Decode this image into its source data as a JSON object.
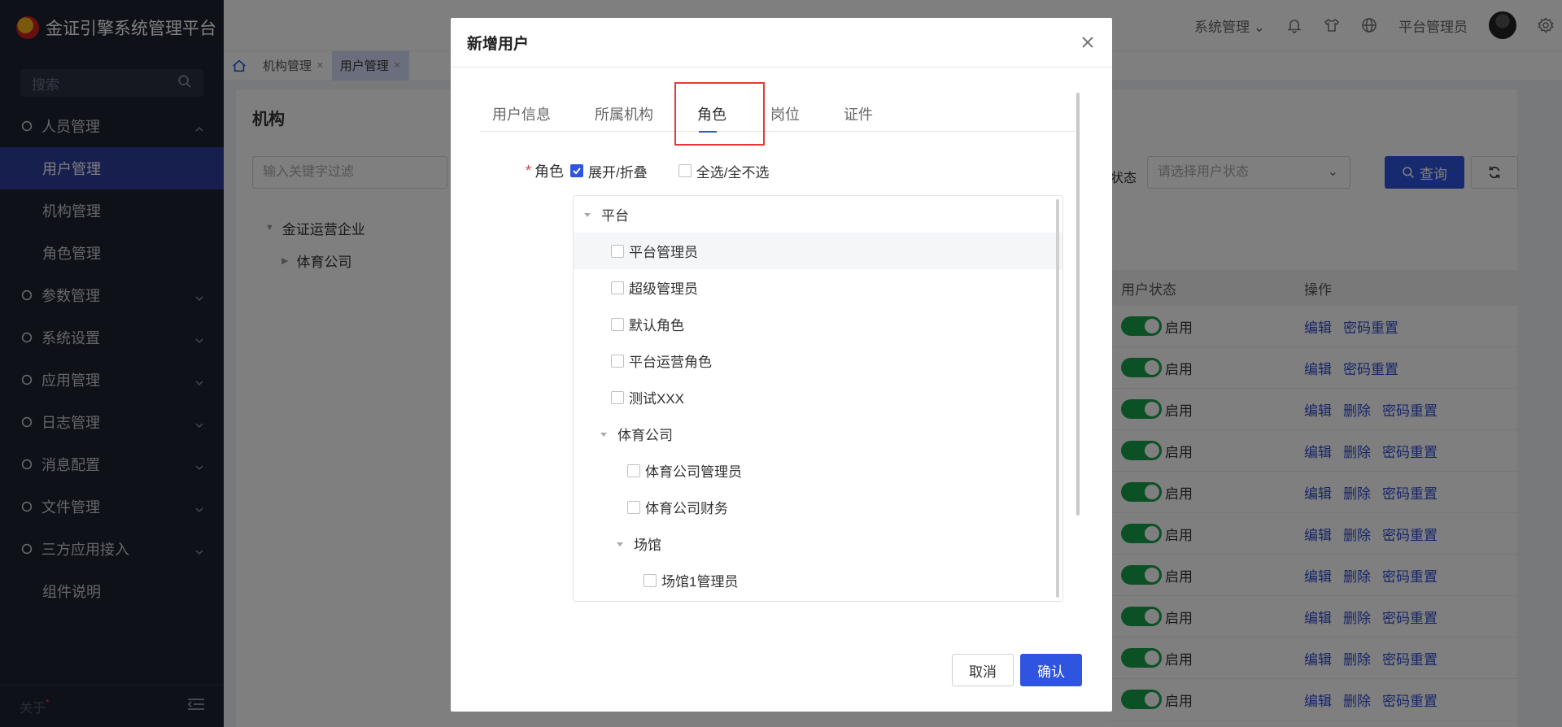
{
  "app": {
    "title": "金证引擎系统管理平台"
  },
  "sidebar": {
    "search_placeholder": "搜索",
    "groups": [
      {
        "label": "人员管理",
        "expanded": true,
        "children": [
          "用户管理",
          "机构管理",
          "角色管理"
        ]
      },
      {
        "label": "参数管理"
      },
      {
        "label": "系统设置"
      },
      {
        "label": "应用管理"
      },
      {
        "label": "日志管理"
      },
      {
        "label": "消息配置"
      },
      {
        "label": "文件管理"
      },
      {
        "label": "三方应用接入"
      },
      {
        "label": "组件说明"
      }
    ],
    "active_item": "用户管理",
    "footer_label": "关于",
    "footer_mark": "*"
  },
  "header": {
    "system_menu": "系统管理",
    "user_name": "平台管理员"
  },
  "tabs": [
    {
      "label": "机构管理",
      "active": false
    },
    {
      "label": "用户管理",
      "active": true
    }
  ],
  "main": {
    "panel_title": "机构",
    "filter_placeholder": "输入关键字过滤",
    "org_tree": [
      "金证运营企业",
      "体育公司"
    ],
    "status_label": "状态",
    "status_placeholder": "请选择用户状态",
    "query_label": "查询",
    "table": {
      "headers": [
        "用户状态",
        "操作"
      ],
      "rows": [
        {
          "status": "启用",
          "actions": [
            "编辑",
            "密码重置"
          ]
        },
        {
          "status": "启用",
          "actions": [
            "编辑",
            "密码重置"
          ]
        },
        {
          "status": "启用",
          "actions": [
            "编辑",
            "删除",
            "密码重置"
          ]
        },
        {
          "status": "启用",
          "actions": [
            "编辑",
            "删除",
            "密码重置"
          ]
        },
        {
          "status": "启用",
          "actions": [
            "编辑",
            "删除",
            "密码重置"
          ]
        },
        {
          "status": "启用",
          "actions": [
            "编辑",
            "删除",
            "密码重置"
          ]
        },
        {
          "status": "启用",
          "actions": [
            "编辑",
            "删除",
            "密码重置"
          ]
        },
        {
          "status": "启用",
          "actions": [
            "编辑",
            "删除",
            "密码重置"
          ]
        },
        {
          "status": "启用",
          "actions": [
            "编辑",
            "删除",
            "密码重置"
          ]
        },
        {
          "status": "启用",
          "actions": [
            "编辑",
            "删除",
            "密码重置"
          ]
        }
      ]
    }
  },
  "dialog": {
    "title": "新增用户",
    "tabs": [
      "用户信息",
      "所属机构",
      "角色",
      "岗位",
      "证件"
    ],
    "active_tab": "角色",
    "role_label": "角色",
    "expand_label": "展开/折叠",
    "expand_checked": true,
    "select_all_label": "全选/全不选",
    "select_all_checked": false,
    "tree": [
      {
        "label": "平台",
        "level": 0,
        "type": "branch"
      },
      {
        "label": "平台管理员",
        "level": 1,
        "type": "leaf",
        "highlight": true
      },
      {
        "label": "超级管理员",
        "level": 1,
        "type": "leaf"
      },
      {
        "label": "默认角色",
        "level": 1,
        "type": "leaf"
      },
      {
        "label": "平台运营角色",
        "level": 1,
        "type": "leaf"
      },
      {
        "label": "测试XXX",
        "level": 1,
        "type": "leaf"
      },
      {
        "label": "体育公司",
        "level": 1,
        "type": "branch"
      },
      {
        "label": "体育公司管理员",
        "level": 2,
        "type": "leaf"
      },
      {
        "label": "体育公司财务",
        "level": 2,
        "type": "leaf"
      },
      {
        "label": "场馆",
        "level": 2,
        "type": "branch"
      },
      {
        "label": "场馆1管理员",
        "level": 3,
        "type": "leaf"
      }
    ],
    "cancel_label": "取消",
    "ok_label": "确认"
  }
}
